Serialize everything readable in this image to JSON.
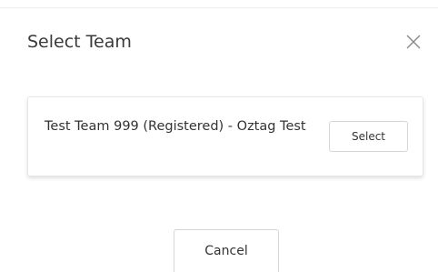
{
  "dialog": {
    "title": "Select Team",
    "close_icon": "close-icon"
  },
  "teams": [
    {
      "name": "Test Team 999 (Registered) - Oztag Test",
      "select_label": "Select"
    }
  ],
  "footer": {
    "cancel_label": "Cancel"
  }
}
